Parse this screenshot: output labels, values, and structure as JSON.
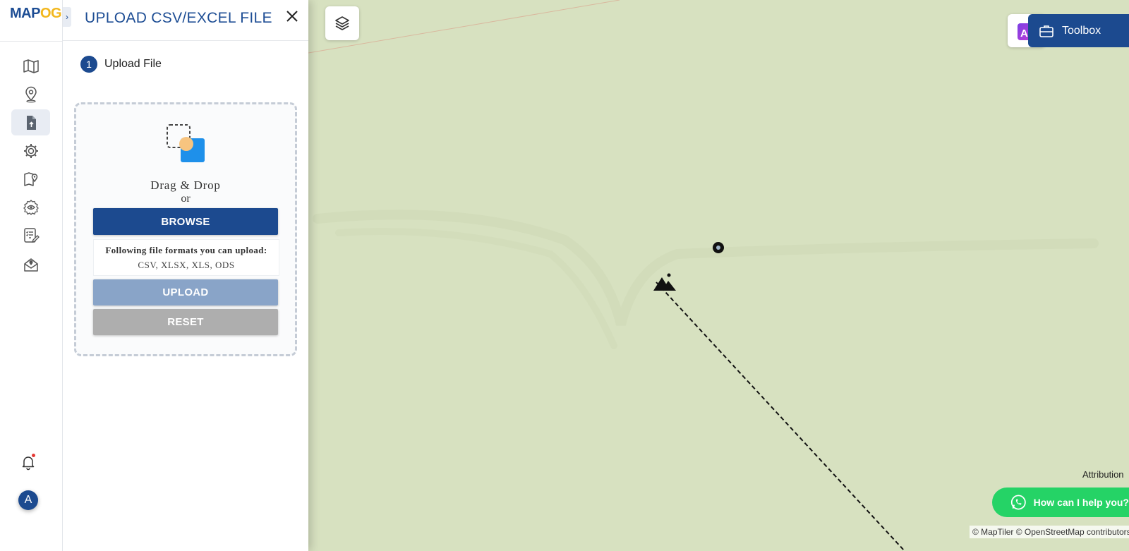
{
  "app": {
    "logo_part1": "MAP",
    "logo_part2": "OG"
  },
  "rail": {
    "items": [
      {
        "name": "map-icon",
        "active": false
      },
      {
        "name": "location-pin-icon",
        "active": false
      },
      {
        "name": "file-upload-icon",
        "active": true
      },
      {
        "name": "settings-gear-icon",
        "active": false
      },
      {
        "name": "map-location-icon",
        "active": false
      },
      {
        "name": "eye-settings-icon",
        "active": false
      },
      {
        "name": "checklist-edit-icon",
        "active": false
      },
      {
        "name": "map-envelope-icon",
        "active": false
      }
    ],
    "avatar_initial": "A"
  },
  "panel": {
    "title": "UPLOAD CSV/EXCEL FILE",
    "step_number": "1",
    "step_label": "Upload File",
    "drag_drop": "Drag & Drop",
    "or": "or",
    "browse_label": "BROWSE",
    "formats_title": "Following file formats you can upload:",
    "formats_list": "CSV, XLSX, XLS, ODS",
    "upload_label": "UPLOAD",
    "reset_label": "RESET"
  },
  "map": {
    "toolbox_label": "Toolbox",
    "whatsapp_label": "How can I help you?",
    "attribution_label": "Attribution",
    "attribution_text": "© MapTiler © OpenStreetMap contributors"
  },
  "colors": {
    "brand_blue": "#1c4a8f",
    "map_bg": "#d7e1c0",
    "upload_disabled": "#89a4c8",
    "reset_disabled": "#aeaeae",
    "whatsapp_green": "#25d366",
    "logo_yellow": "#f2b71d"
  }
}
